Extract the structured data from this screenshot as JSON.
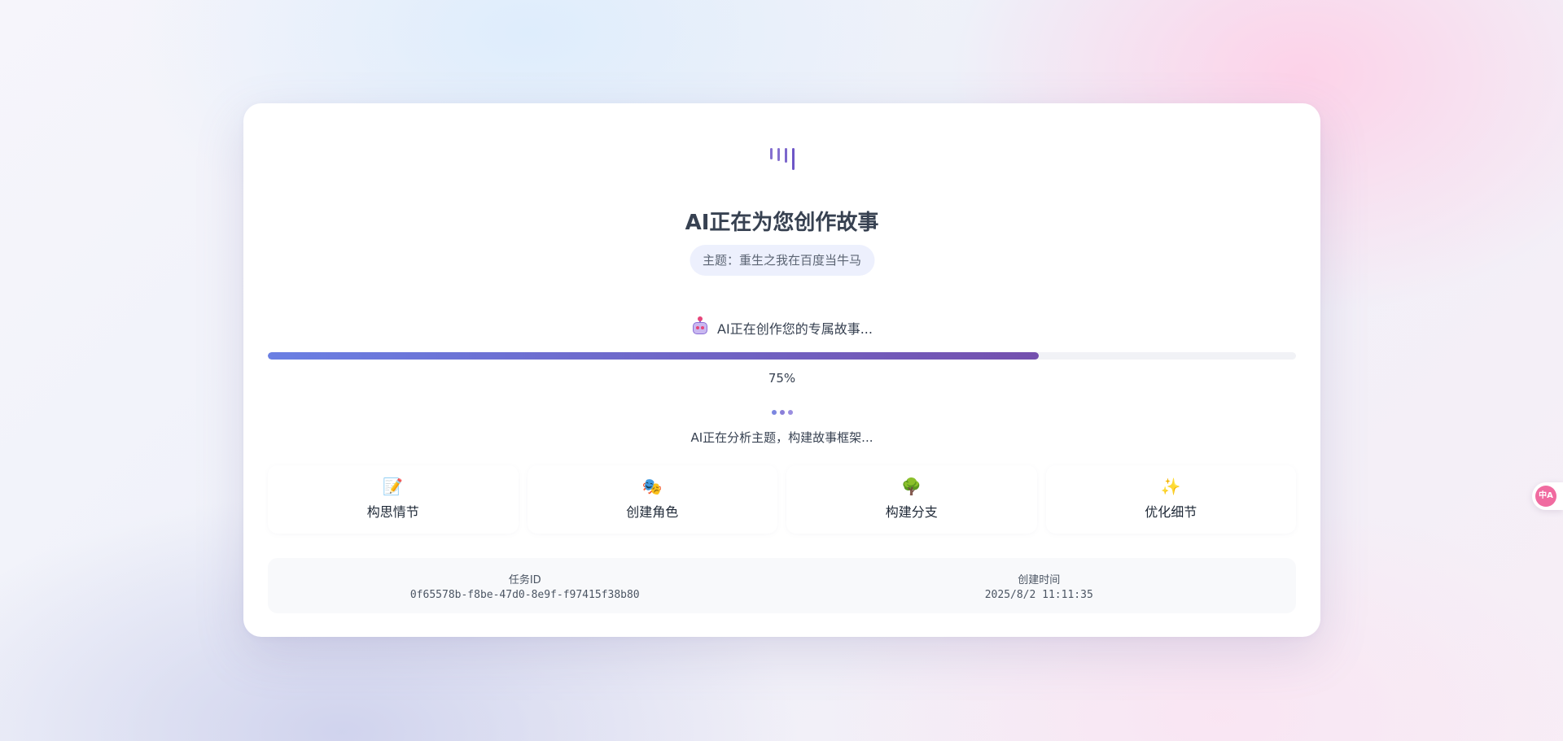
{
  "header": {
    "logo_icon": "sound-bars-icon",
    "title": "AI正在为您创作故事",
    "topic_text": "主题：重生之我在百度当牛马"
  },
  "progress": {
    "status_icon": "robot-icon",
    "status_text": "AI正在创作您的专属故事...",
    "percent_value": 0.75,
    "percent_text": "75%",
    "fill_start_color": "#6a7fe3",
    "fill_end_color": "#7450ae"
  },
  "activity": {
    "dots_icon": "loading-dots-icon",
    "message": "AI正在分析主题，构建故事框架..."
  },
  "steps": [
    {
      "icon": "memo-icon",
      "glyph": "📝",
      "label": "构思情节"
    },
    {
      "icon": "theater-masks-icon",
      "glyph": "🎭",
      "label": "创建角色"
    },
    {
      "icon": "tree-icon",
      "glyph": "🌳",
      "label": "构建分支"
    },
    {
      "icon": "sparkles-icon",
      "glyph": "✨",
      "label": "优化细节"
    }
  ],
  "meta": {
    "task_id_label": "任务ID",
    "task_id_value": "0f65578b-f8be-47d0-8e9f-f97415f38b80",
    "created_label": "创建时间",
    "created_value": "2025/8/2 11:11:35"
  },
  "translate_widget": {
    "icon": "translate-icon",
    "text": "中A"
  },
  "colors": {
    "accent": "#6e56c7",
    "pill_background": "#edf0fd",
    "translate_badge": "#f06ba0"
  }
}
